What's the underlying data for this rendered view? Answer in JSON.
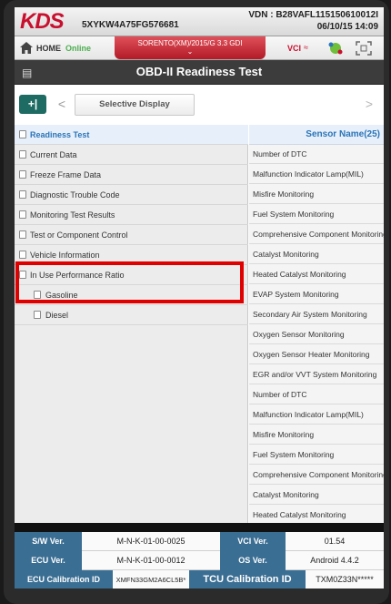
{
  "header": {
    "brand": "KDS",
    "vin": "5XYKW4A75FG576681",
    "vdn": "VDN : B28VAFL115150610012I",
    "datetime": "06/10/15 14:09"
  },
  "homebar": {
    "home_label": "HOME",
    "status": "Online",
    "vehicle": "SORENTO(XM)/2015/G 3.3 GDI",
    "vci_label": "VCI"
  },
  "title": "OBD-II Readiness Test",
  "nav": {
    "back_glyph": "+|",
    "prev_glyph": "<",
    "selective_display": "Selective Display",
    "next_glyph": ">"
  },
  "menu": [
    {
      "label": "Readiness Test",
      "active": true
    },
    {
      "label": "Current Data"
    },
    {
      "label": "Freeze Frame Data"
    },
    {
      "label": "Diagnostic Trouble Code"
    },
    {
      "label": "Monitoring Test Results"
    },
    {
      "label": "Test or Component Control"
    },
    {
      "label": "Vehicle Information"
    },
    {
      "label": "In Use Performance Ratio"
    },
    {
      "label": "Gasoline",
      "sub": true
    },
    {
      "label": "Diesel",
      "sub": true
    }
  ],
  "sensors": {
    "header": "Sensor Name(25)",
    "rows": [
      "Number of DTC",
      "Malfunction Indicator Lamp(MIL)",
      "Misfire Monitoring",
      "Fuel System Monitoring",
      "Comprehensive Component Monitoring",
      "Catalyst Monitoring",
      "Heated Catalyst Monitoring",
      "EVAP System Monitoring",
      "Secondary Air System Monitoring",
      "Oxygen Sensor Monitoring",
      "Oxygen Sensor Heater Monitoring",
      "EGR and/or VVT System Monitoring",
      "Number of DTC",
      "Malfunction Indicator Lamp(MIL)",
      "Misfire Monitoring",
      "Fuel System Monitoring",
      "Comprehensive Component Monitoring",
      "Catalyst Monitoring",
      "Heated Catalyst Monitoring"
    ]
  },
  "info": {
    "sw_label": "S/W Ver.",
    "sw_value": "M-N-K-01-00-0025",
    "vci_label": "VCI Ver.",
    "vci_value": "01.54",
    "ecu_label": "ECU Ver.",
    "ecu_value": "M-N-K-01-00-0012",
    "os_label": "OS Ver.",
    "os_value": "Android 4.4.2",
    "ecucal_label": "ECU Calibration ID",
    "ecucal_value": "XMFN33GM2A6CL5B*",
    "tcucal_label": "TCU Calibration ID",
    "tcucal_value": "TXM0Z33N*****"
  },
  "colors": {
    "accent_red": "#c8102e",
    "header_blue": "#2b74b8",
    "label_blue": "#3b6e93",
    "back_green": "#1d6b62",
    "highlight": "#e10000"
  }
}
